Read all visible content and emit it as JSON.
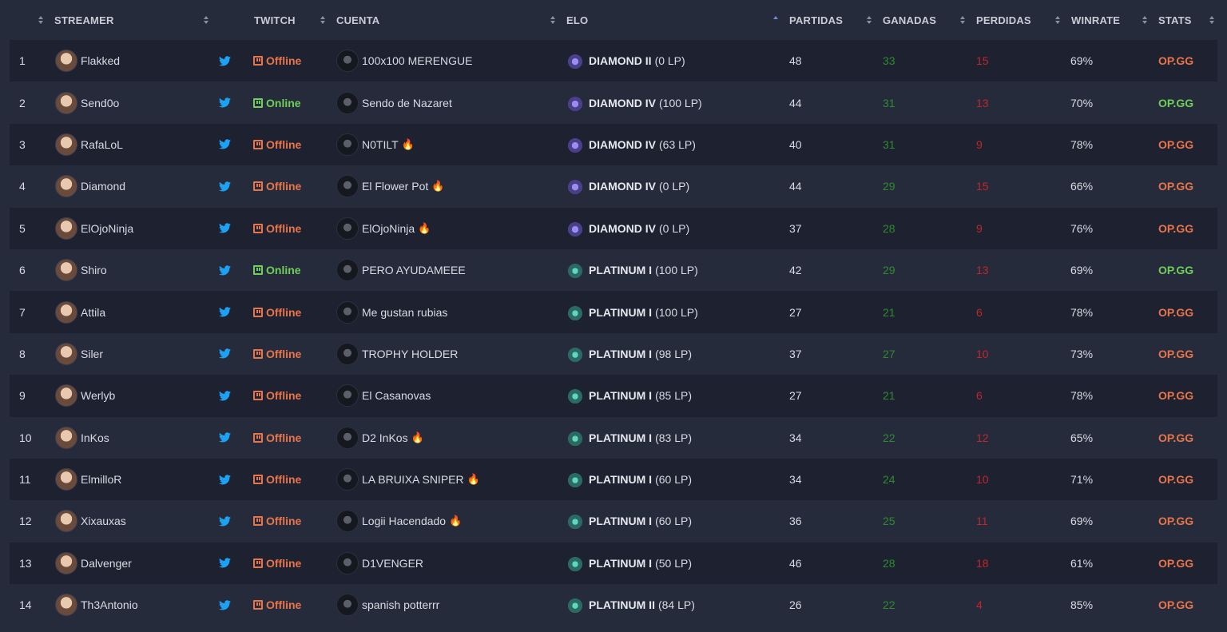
{
  "header": {
    "streamer": "STREAMER",
    "twitch": "TWITCH",
    "cuenta": "CUENTA",
    "elo": "ELO",
    "partidas": "PARTIDAS",
    "ganadas": "GANADAS",
    "perdidas": "PERDIDAS",
    "winrate": "WINRATE",
    "stats": "STATS"
  },
  "colors": {
    "background": "#262b3b",
    "row_alt": "#1d2130",
    "offline": "#e8754a",
    "online": "#6fcf5a",
    "wins": "#2f8a2f",
    "losses": "#c0262b",
    "twitter": "#1da1f2"
  },
  "rows": [
    {
      "rank": "1",
      "streamer": "Flakked",
      "status": "Offline",
      "account": "100x100 MERENGUE",
      "fire": "",
      "tier": "DIAMOND II",
      "lp": "(0 LP)",
      "rank_icon": "diamond",
      "games": "48",
      "wins": "33",
      "losses": "15",
      "winrate": "69%",
      "stats": "OP.GG"
    },
    {
      "rank": "2",
      "streamer": "Send0o",
      "status": "Online",
      "account": "Sendo de Nazaret",
      "fire": "",
      "tier": "DIAMOND IV",
      "lp": "(100 LP)",
      "rank_icon": "diamond",
      "games": "44",
      "wins": "31",
      "losses": "13",
      "winrate": "70%",
      "stats": "OP.GG"
    },
    {
      "rank": "3",
      "streamer": "RafaLoL",
      "status": "Offline",
      "account": "N0TILT",
      "fire": "🔥",
      "tier": "DIAMOND IV",
      "lp": "(63 LP)",
      "rank_icon": "diamond",
      "games": "40",
      "wins": "31",
      "losses": "9",
      "winrate": "78%",
      "stats": "OP.GG"
    },
    {
      "rank": "4",
      "streamer": "Diamond",
      "status": "Offline",
      "account": "El Flower Pot",
      "fire": "🔥",
      "tier": "DIAMOND IV",
      "lp": "(0 LP)",
      "rank_icon": "diamond",
      "games": "44",
      "wins": "29",
      "losses": "15",
      "winrate": "66%",
      "stats": "OP.GG"
    },
    {
      "rank": "5",
      "streamer": "ElOjoNinja",
      "status": "Offline",
      "account": "ElOjoNinja",
      "fire": "🔥",
      "tier": "DIAMOND IV",
      "lp": "(0 LP)",
      "rank_icon": "diamond",
      "games": "37",
      "wins": "28",
      "losses": "9",
      "winrate": "76%",
      "stats": "OP.GG"
    },
    {
      "rank": "6",
      "streamer": "Shiro",
      "status": "Online",
      "account": "PERO AYUDAMEEE",
      "fire": "",
      "tier": "PLATINUM I",
      "lp": "(100 LP)",
      "rank_icon": "platinum",
      "games": "42",
      "wins": "29",
      "losses": "13",
      "winrate": "69%",
      "stats": "OP.GG"
    },
    {
      "rank": "7",
      "streamer": "Attila",
      "status": "Offline",
      "account": "Me gustan rubias",
      "fire": "",
      "tier": "PLATINUM I",
      "lp": "(100 LP)",
      "rank_icon": "platinum",
      "games": "27",
      "wins": "21",
      "losses": "6",
      "winrate": "78%",
      "stats": "OP.GG"
    },
    {
      "rank": "8",
      "streamer": "Siler",
      "status": "Offline",
      "account": "TROPHY HOLDER",
      "fire": "",
      "tier": "PLATINUM I",
      "lp": "(98 LP)",
      "rank_icon": "platinum",
      "games": "37",
      "wins": "27",
      "losses": "10",
      "winrate": "73%",
      "stats": "OP.GG"
    },
    {
      "rank": "9",
      "streamer": "Werlyb",
      "status": "Offline",
      "account": "El Casanovas",
      "fire": "",
      "tier": "PLATINUM I",
      "lp": "(85 LP)",
      "rank_icon": "platinum",
      "games": "27",
      "wins": "21",
      "losses": "6",
      "winrate": "78%",
      "stats": "OP.GG"
    },
    {
      "rank": "10",
      "streamer": "InKos",
      "status": "Offline",
      "account": "D2 InKos",
      "fire": "🔥",
      "tier": "PLATINUM I",
      "lp": "(83 LP)",
      "rank_icon": "platinum",
      "games": "34",
      "wins": "22",
      "losses": "12",
      "winrate": "65%",
      "stats": "OP.GG"
    },
    {
      "rank": "11",
      "streamer": "ElmilloR",
      "status": "Offline",
      "account": "LA BRUIXA SNIPER",
      "fire": "🔥",
      "tier": "PLATINUM I",
      "lp": "(60 LP)",
      "rank_icon": "platinum",
      "games": "34",
      "wins": "24",
      "losses": "10",
      "winrate": "71%",
      "stats": "OP.GG"
    },
    {
      "rank": "12",
      "streamer": "Xixauxas",
      "status": "Offline",
      "account": "Logii Hacendado",
      "fire": "🔥",
      "tier": "PLATINUM I",
      "lp": "(60 LP)",
      "rank_icon": "platinum",
      "games": "36",
      "wins": "25",
      "losses": "11",
      "winrate": "69%",
      "stats": "OP.GG"
    },
    {
      "rank": "13",
      "streamer": "Dalvenger",
      "status": "Offline",
      "account": "D1VENGER",
      "fire": "",
      "tier": "PLATINUM I",
      "lp": "(50 LP)",
      "rank_icon": "platinum",
      "games": "46",
      "wins": "28",
      "losses": "18",
      "winrate": "61%",
      "stats": "OP.GG"
    },
    {
      "rank": "14",
      "streamer": "Th3Antonio",
      "status": "Offline",
      "account": "spanish potterrr",
      "fire": "",
      "tier": "PLATINUM II",
      "lp": "(84 LP)",
      "rank_icon": "platinum",
      "games": "26",
      "wins": "22",
      "losses": "4",
      "winrate": "85%",
      "stats": "OP.GG"
    }
  ]
}
